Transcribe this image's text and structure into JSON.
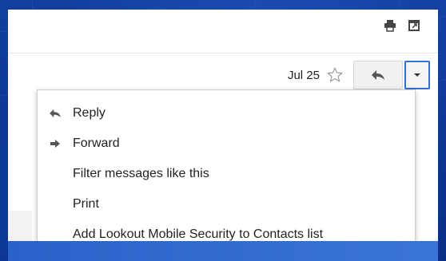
{
  "toolbar": {
    "print_icon": "print-icon",
    "new_window_icon": "open-in-new-window-icon"
  },
  "message": {
    "date": "Jul 25",
    "star_icon": "star-outline-icon",
    "reply_icon": "reply-arrow-icon",
    "more_icon": "caret-down-icon"
  },
  "menu": {
    "items": [
      {
        "label": "Reply",
        "icon": "reply-arrow-icon"
      },
      {
        "label": "Forward",
        "icon": "forward-arrow-icon"
      },
      {
        "label": "Filter messages like this",
        "icon": ""
      },
      {
        "label": "Print",
        "icon": ""
      },
      {
        "label": "Add Lookout Mobile Security to Contacts list",
        "icon": ""
      }
    ]
  },
  "colors": {
    "background": "#0a2f86",
    "focus_border": "#2f6fd8"
  }
}
